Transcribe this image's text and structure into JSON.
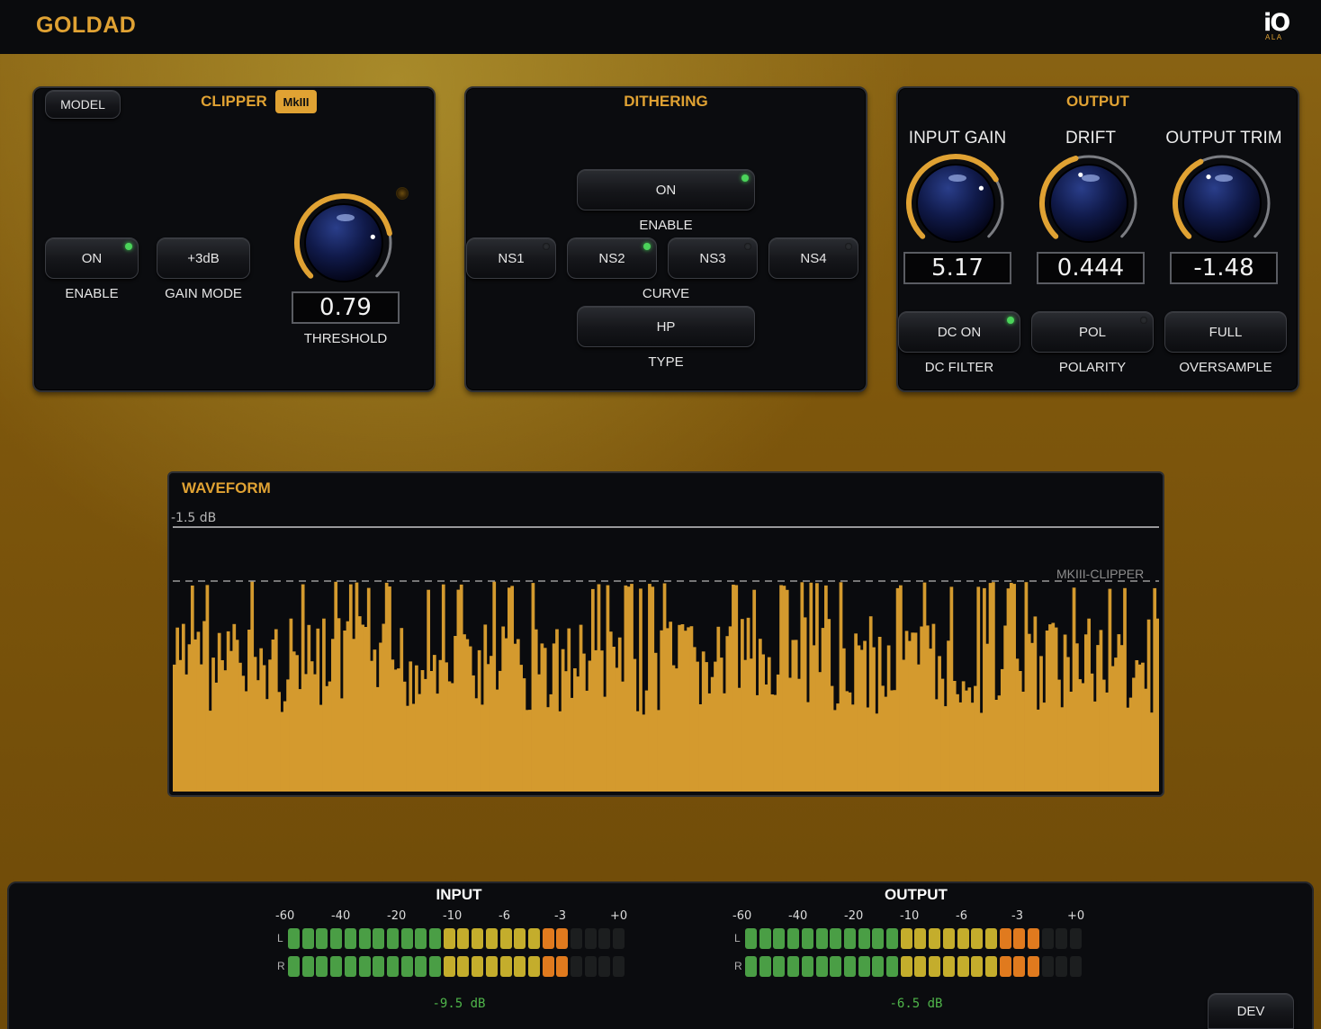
{
  "app": {
    "title": "GOLDAD",
    "logo_mark": "iO",
    "logo_sub": "ALA"
  },
  "clipper": {
    "title": "CLIPPER",
    "model_badge": "MkIII",
    "model_button": "MODEL",
    "enable_button": "ON",
    "enable_label": "ENABLE",
    "gain_mode_button": "+3dB",
    "gain_mode_label": "GAIN MODE",
    "threshold_value": "0.79",
    "threshold_label": "THRESHOLD",
    "threshold_level": 0.79
  },
  "dithering": {
    "title": "DITHERING",
    "enable_button": "ON",
    "enable_label": "ENABLE",
    "curves": [
      "NS1",
      "NS2",
      "NS3",
      "NS4"
    ],
    "active_curve": "NS2",
    "curve_label": "CURVE",
    "type_button": "HP",
    "type_label": "TYPE"
  },
  "output": {
    "title": "OUTPUT",
    "knobs": [
      {
        "label": "INPUT GAIN",
        "value": "5.17",
        "level": 0.72
      },
      {
        "label": "DRIFT",
        "value": "0.444",
        "level": 0.44
      },
      {
        "label": "OUTPUT TRIM",
        "value": "-1.48",
        "level": 0.4
      }
    ],
    "dc_button": "DC ON",
    "dc_label": "DC FILTER",
    "polarity_button": "POL",
    "polarity_label": "POLARITY",
    "oversample_button": "FULL",
    "oversample_label": "OVERSAMPLE"
  },
  "waveform": {
    "title": "WAVEFORM",
    "ceiling_label": "-1.5 dB",
    "clip_label": "MKIII-CLIPPER"
  },
  "meters": {
    "scale": [
      "-60",
      "-40",
      "-20",
      "-10",
      "-6",
      "-3",
      "+0"
    ],
    "channels": [
      "L",
      "R"
    ],
    "input": {
      "title": "INPUT",
      "readout": "-9.5 dB",
      "lit_segments": 20
    },
    "output": {
      "title": "OUTPUT",
      "readout": "-6.5 dB",
      "lit_segments": 21
    },
    "total_segments": 24
  },
  "dev_button": "DEV",
  "colors": {
    "accent": "#e0a233",
    "led_on": "#4bd35a",
    "meter_green": "#4a9e45",
    "meter_yellow": "#c4ad2c",
    "meter_orange": "#e07a1e"
  }
}
